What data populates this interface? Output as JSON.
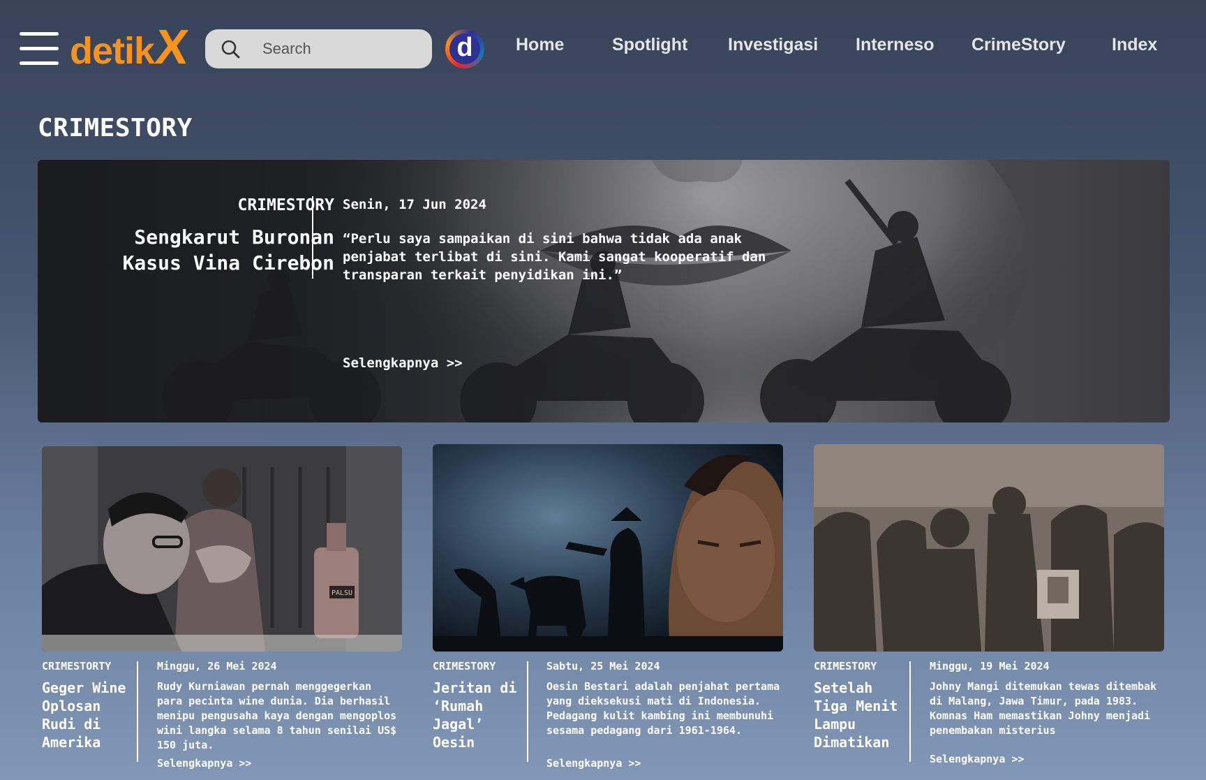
{
  "header": {
    "logo_main": "detik",
    "logo_accent": "X",
    "search_placeholder": "Search",
    "dlogo_letter": "d",
    "nav": [
      {
        "label": "Home"
      },
      {
        "label": "Spotlight"
      },
      {
        "label": "Investigasi"
      },
      {
        "label": "Interneso"
      },
      {
        "label": "CrimeStory"
      },
      {
        "label": "Index"
      }
    ]
  },
  "page": {
    "title": "CRIMESTORY"
  },
  "hero": {
    "kicker": "CRIMESTORY",
    "title": "Sengkarut Buronan Kasus Vina Cirebon",
    "date": "Senin, 17 Jun 2024",
    "quote": "“Perlu saya sampaikan di sini bahwa tidak ada anak penjabat terlibat di sini. Kami sangat kooperatif dan transparan terkait penyidikan ini.”",
    "more": "Selengkapnya >>"
  },
  "cards": [
    {
      "kicker": "CRIMESTORTY",
      "title": "Geger Wine Oplosan Rudi di Amerika",
      "date": "Minggu, 26 Mei 2024",
      "summary": "Rudy Kurniawan pernah menggegerkan para pecinta wine dunia. Dia berhasil menipu pengusaha kaya dengan mengoplos wini langka selama 8 tahun senilai US$ 150 juta.",
      "more": "Selengkapnya >>",
      "image_label": "PALSU"
    },
    {
      "kicker": "CRIMESTORY",
      "title": "Jeritan di ‘Rumah Jagal’ Oesin",
      "date": "Sabtu, 25 Mei 2024",
      "summary": "Oesin Bestari adalah penjahat pertama yang dieksekusi mati di Indonesia. Pedagang kulit kambing ini membunuhi sesama pedagang dari 1961-1964.",
      "more": "Selengkapnya >>"
    },
    {
      "kicker": "CRIMESTORY",
      "title": "Setelah Tiga Menit Lampu Dimatikan",
      "date": "Minggu, 19 Mei 2024",
      "summary": "Johny Mangi ditemukan tewas ditembak di Malang, Jawa Timur, pada 1983. Komnas Ham memastikan Johny menjadi penembakan misterius",
      "more": "Selengkapnya >>"
    }
  ],
  "colors": {
    "brand_orange": "#f7931e",
    "bg_top": "#374357",
    "bg_bottom": "#8296b6",
    "search_bg": "#d9d9d9"
  },
  "icons": [
    "hamburger-menu-icon",
    "search-icon",
    "detik-d-logo"
  ]
}
